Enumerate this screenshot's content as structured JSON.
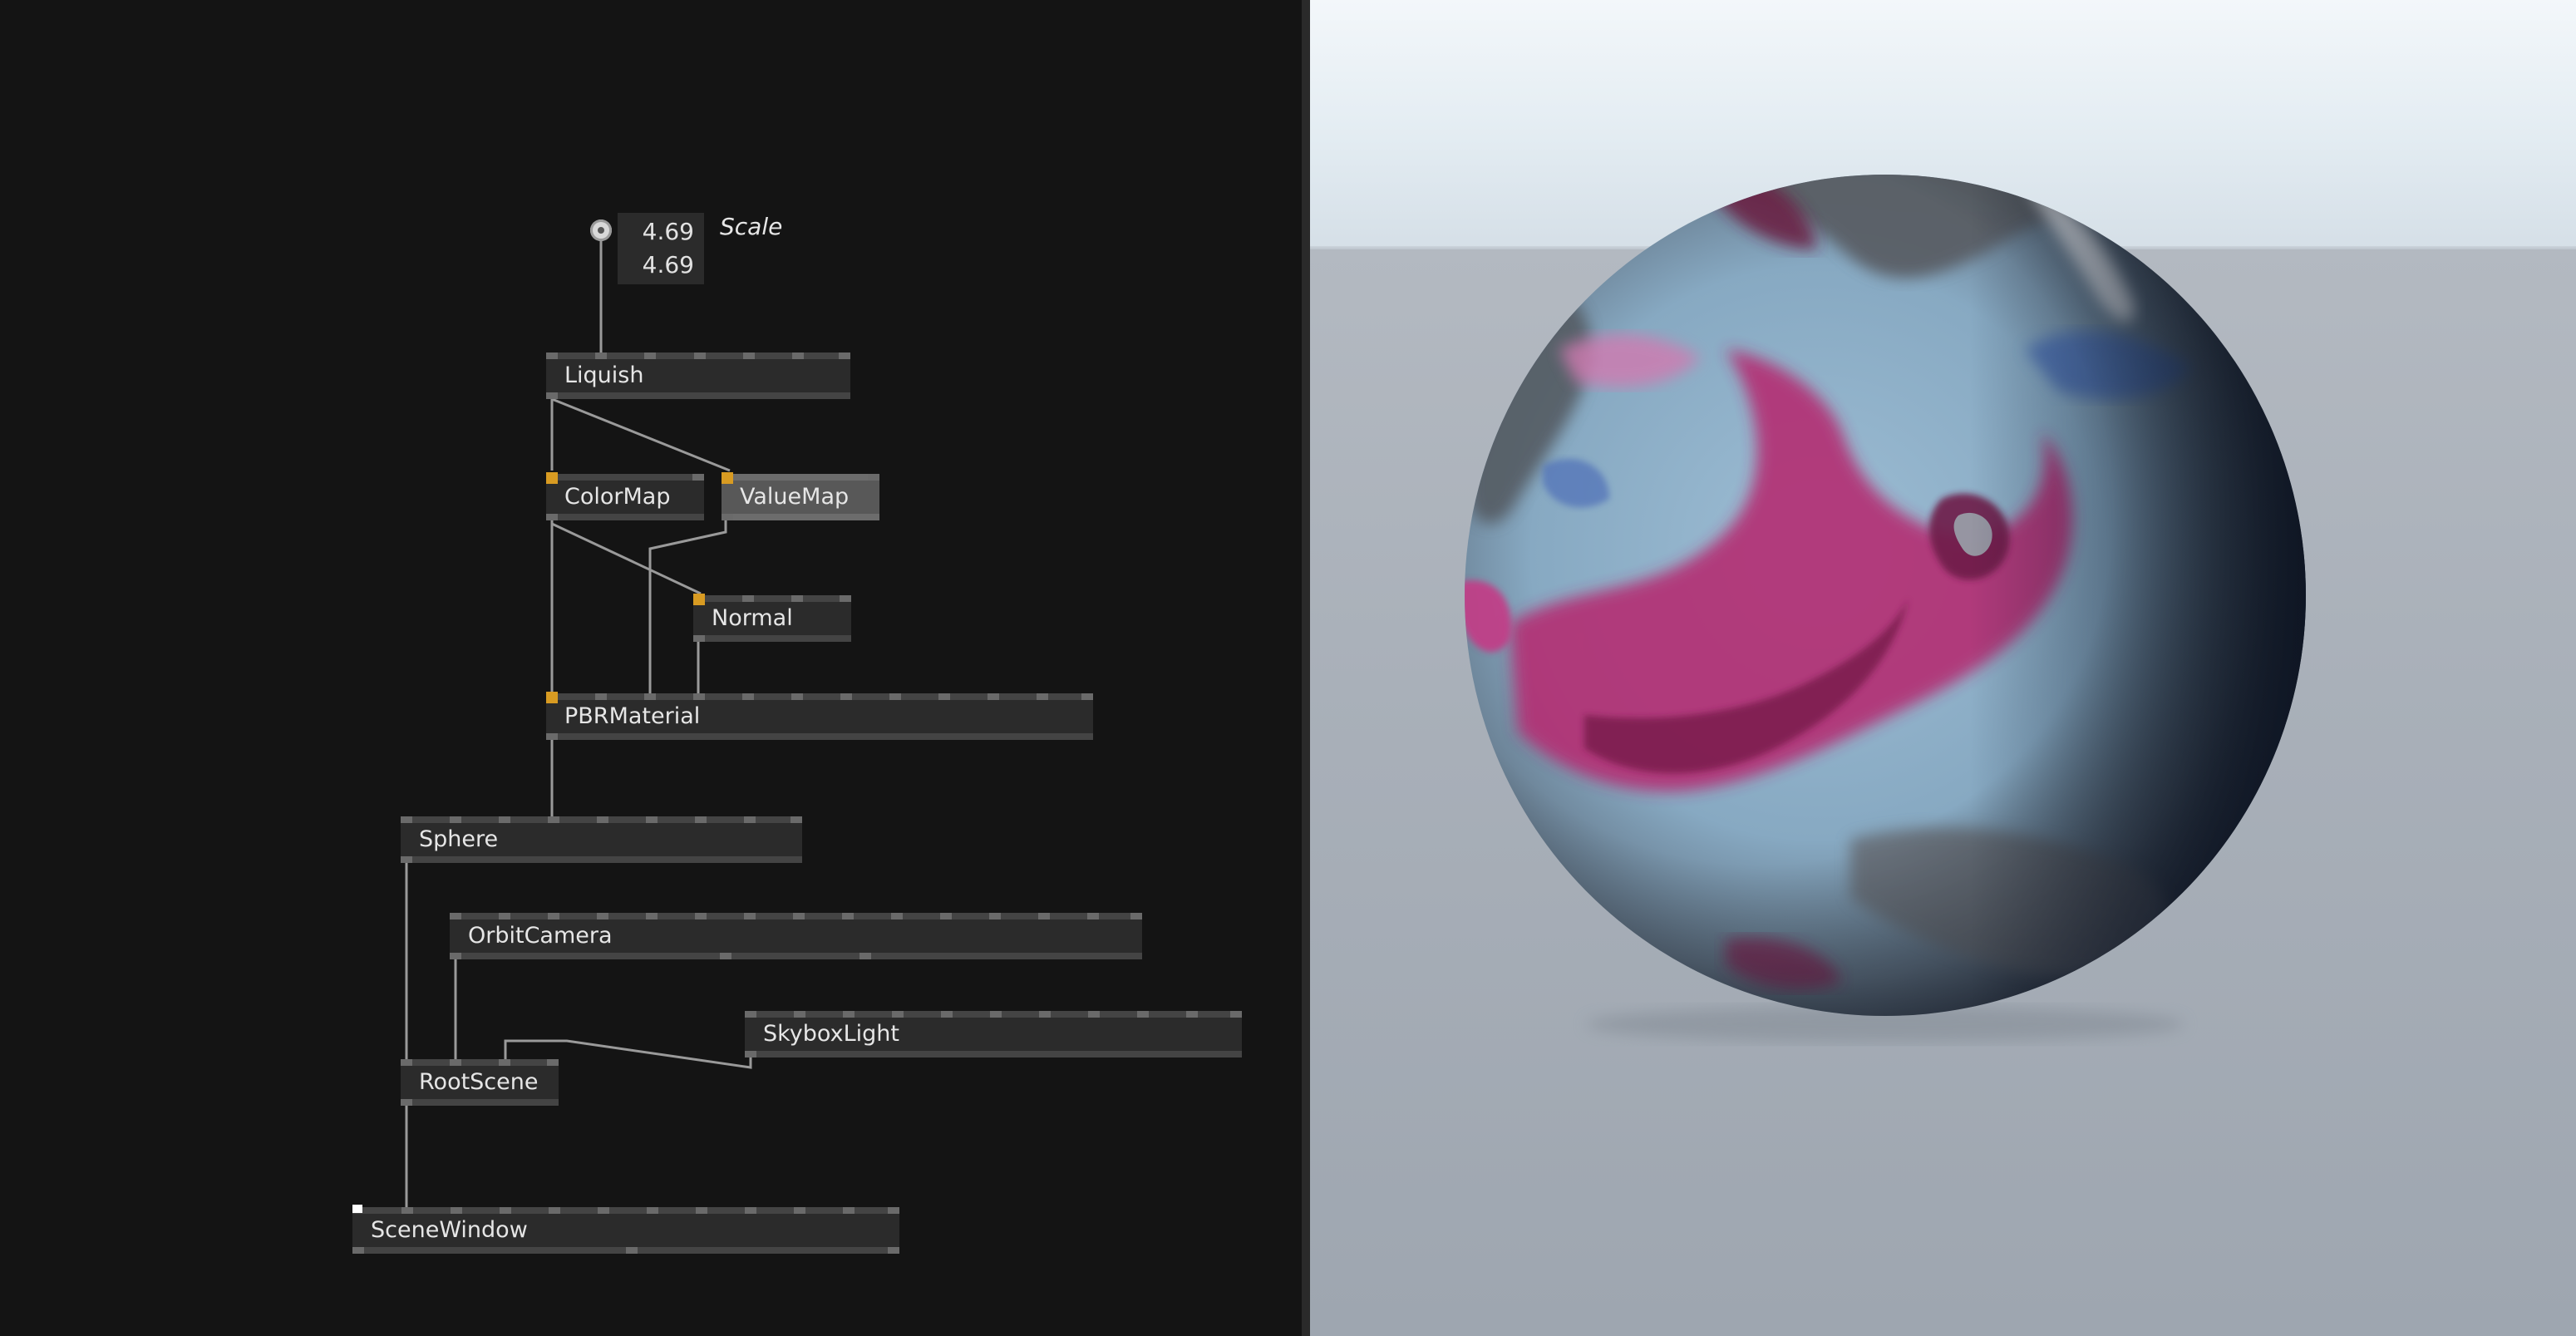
{
  "editor": {
    "scale_widget": {
      "label": "Scale",
      "value_x": "4.69",
      "value_y": "4.69"
    },
    "nodes": {
      "liquish": "Liquish",
      "colormap": "ColorMap",
      "valuemap": "ValueMap",
      "normal": "Normal",
      "pbrmaterial": "PBRMaterial",
      "sphere": "Sphere",
      "orbitcamera": "OrbitCamera",
      "skyboxlight": "SkyboxLight",
      "rootscene": "RootScene",
      "scenewindow": "SceneWindow"
    },
    "colors": {
      "background": "#141414",
      "node": "#2b2b2b",
      "node_selected": "#585858",
      "active_pin": "#d89b22",
      "link": "#9a9a9a"
    }
  },
  "viewport": {
    "icon": "textured-sphere",
    "colors": {
      "sky": "#e6eef4",
      "ground": "#a6adb6",
      "sphere_base": "#8fb2cc",
      "sphere_accent": "#b32d78"
    }
  }
}
